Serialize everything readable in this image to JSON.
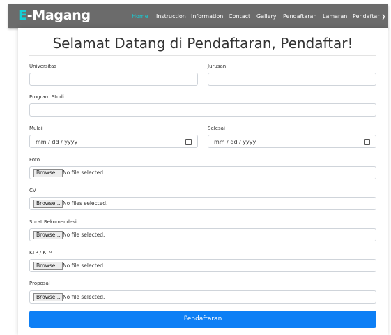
{
  "brand": {
    "accent": "E",
    "rest": "-Magang"
  },
  "nav": {
    "items": [
      "Home",
      "Instruction",
      "Information",
      "Contact",
      "Gallery",
      "Pendaftaran",
      "Lamaran",
      "Pendaftar"
    ],
    "active": "Home",
    "active_color": "#14cfd6"
  },
  "form": {
    "title": "Selamat Datang di Pendaftaran, Pendaftar!",
    "universitas_label": "Universitas",
    "jurusan_label": "Jurusan",
    "program_studi_label": "Program Studi",
    "mulai_label": "Mulai",
    "selesai_label": "Selesai",
    "date_placeholder": "mm / dd / yyyy",
    "foto_label": "Foto",
    "cv_label": "CV",
    "surat_label": "Surat Rekomendasi",
    "ktp_label": "KTP / KTM",
    "proposal_label": "Proposal",
    "browse_label": "Browse...",
    "no_file": "No file selected.",
    "no_files": "No files selected.",
    "submit_label": "Pendaftaran",
    "submit_color": "#0d7ff5"
  }
}
